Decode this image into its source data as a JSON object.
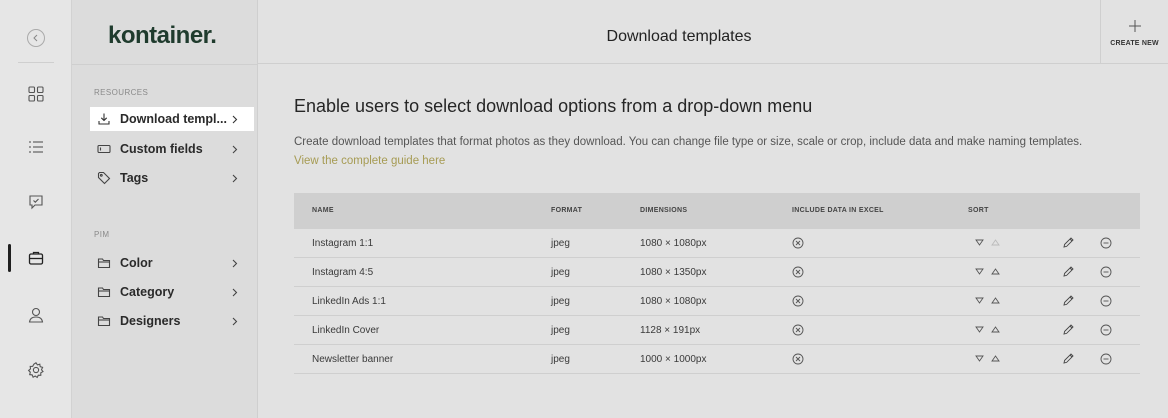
{
  "brand": {
    "logo": "kontainer."
  },
  "header": {
    "title": "Download templates",
    "create_label": "CREATE NEW"
  },
  "sidebar": {
    "sections": [
      {
        "label": "RESOURCES",
        "items": [
          {
            "label": "Download templ...",
            "icon": "download-icon"
          },
          {
            "label": "Custom fields",
            "icon": "textbox-icon"
          },
          {
            "label": "Tags",
            "icon": "tag-icon"
          }
        ]
      },
      {
        "label": "PIM",
        "items": [
          {
            "label": "Color",
            "icon": "folder-icon"
          },
          {
            "label": "Category",
            "icon": "folder-icon"
          },
          {
            "label": "Designers",
            "icon": "folder-icon"
          }
        ]
      }
    ]
  },
  "main": {
    "headline": "Enable users to select download options from a drop-down menu",
    "description": "Create download templates that format photos as they download. You can change file type or size, scale or crop, include data and make naming templates.",
    "guide_link": "View the complete guide here"
  },
  "table": {
    "columns": [
      "NAME",
      "FORMAT",
      "DIMENSIONS",
      "INCLUDE DATA IN EXCEL",
      "SORT"
    ],
    "rows": [
      {
        "name": "Instagram 1:1",
        "format": "jpeg",
        "dimensions": "1080 × 1080px"
      },
      {
        "name": "Instagram 4:5",
        "format": "jpeg",
        "dimensions": "1080 × 1350px"
      },
      {
        "name": "LinkedIn Ads 1:1",
        "format": "jpeg",
        "dimensions": "1080 × 1080px"
      },
      {
        "name": "LinkedIn Cover",
        "format": "jpeg",
        "dimensions": "1128 × 191px"
      },
      {
        "name": "Newsletter banner",
        "format": "jpeg",
        "dimensions": "1000 × 1000px"
      }
    ]
  },
  "colors": {
    "link": "#a69b53",
    "brand": "#1f3b2d",
    "active_bg": "#ffffff"
  }
}
